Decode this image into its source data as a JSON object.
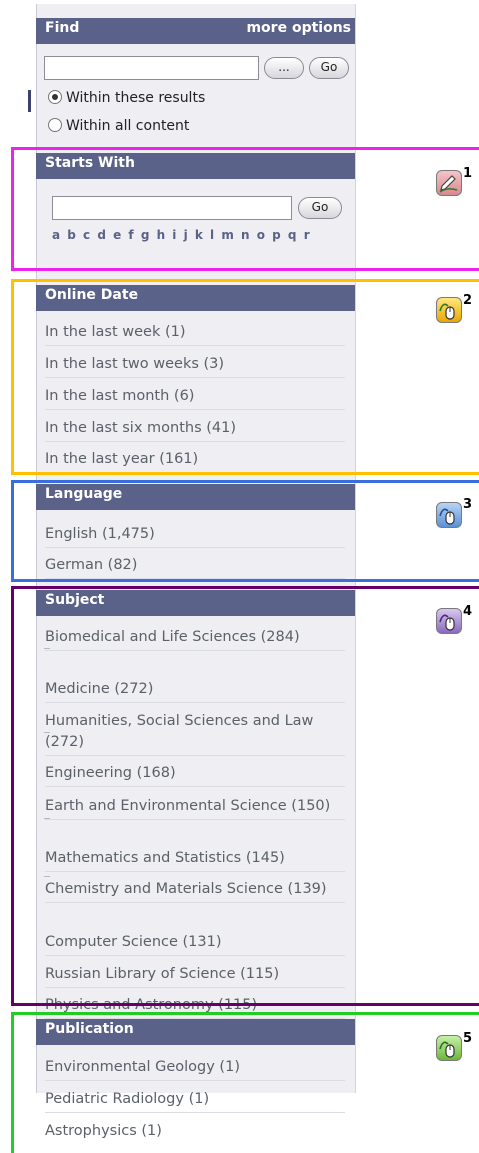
{
  "find": {
    "title": "Find",
    "more_options": "more options",
    "input_value": "",
    "ellipsis_label": "...",
    "go_label": "Go",
    "radio_within_results": "Within these results",
    "radio_all_content": "Within all content",
    "selected": "Within these results"
  },
  "starts_with": {
    "title": "Starts With",
    "input_value": "",
    "go_label": "Go",
    "letters": "a b c d e f g h i j k l m n o p q r"
  },
  "online_date": {
    "title": "Online Date",
    "items": [
      "In the last week (1)",
      "In the last two weeks (3)",
      "In the last month (6)",
      "In the last six months (41)",
      "In the last year (161)"
    ]
  },
  "language": {
    "title": "Language",
    "items": [
      "English (1,475)",
      "German (82)"
    ]
  },
  "subject": {
    "title": "Subject",
    "items": [
      "Biomedical and Life Sciences (284)",
      "Medicine (272)",
      "Humanities, Social Sciences and Law (272)",
      "Engineering (168)",
      "Earth and Environmental Science (150)",
      "Mathematics and Statistics (145)",
      "Chemistry and Materials Science (139)",
      "Computer Science (131)",
      "Russian Library of Science (115)",
      "Physics and Astronomy (115)"
    ]
  },
  "publication": {
    "title": "Publication",
    "items": [
      "Environmental Geology (1)",
      "Pediatric Radiology (1)",
      "Astrophysics (1)"
    ]
  },
  "markers": [
    {
      "number": "1",
      "icon": "pen-edit-icon",
      "color": "#e8a0a8"
    },
    {
      "number": "2",
      "icon": "mouse-click-icon",
      "color": "#f0c020"
    },
    {
      "number": "3",
      "icon": "mouse-click-icon",
      "color": "#6aa0e0"
    },
    {
      "number": "4",
      "icon": "mouse-click-icon",
      "color": "#9a78c8"
    },
    {
      "number": "5",
      "icon": "mouse-click-icon",
      "color": "#7ac24a"
    }
  ],
  "frame_colors": {
    "starts_with": "#ee22ee",
    "online_date": "#ffc000",
    "language": "#3a6de0",
    "subject": "#660066",
    "publication": "#22cc22"
  }
}
